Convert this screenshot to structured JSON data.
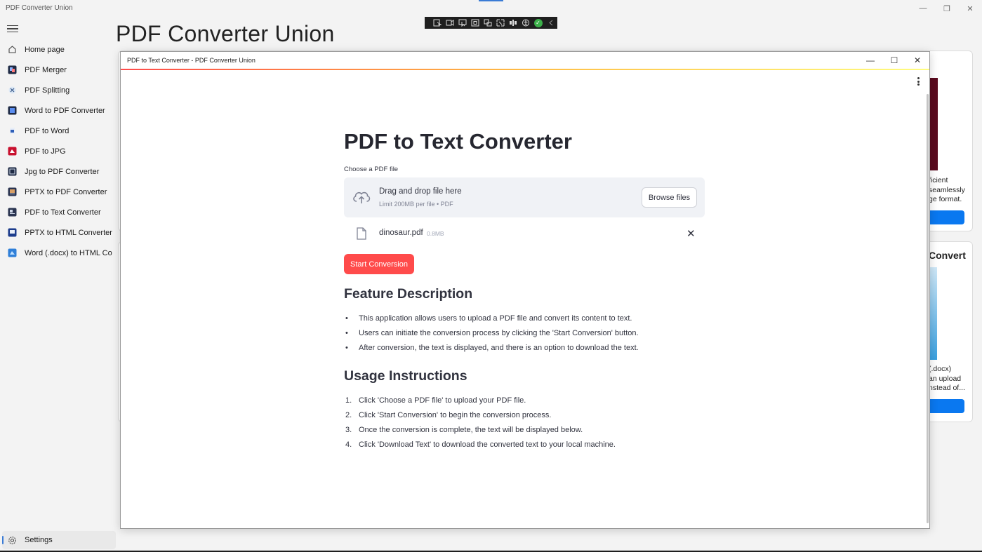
{
  "app": {
    "title": "PDF Converter Union",
    "main_title": "PDF Converter Union"
  },
  "window_controls": {
    "minimize": "—",
    "restore": "❐",
    "close": "✕"
  },
  "sidebar": {
    "items": [
      {
        "label": "Home page",
        "icon": "home-icon"
      },
      {
        "label": "PDF Merger",
        "icon": "pdf-merger-icon"
      },
      {
        "label": "PDF Splitting",
        "icon": "pdf-splitting-icon"
      },
      {
        "label": "Word to PDF Converter",
        "icon": "word-to-pdf-icon"
      },
      {
        "label": "PDF to Word",
        "icon": "pdf-to-word-icon"
      },
      {
        "label": "PDF to JPG",
        "icon": "pdf-to-jpg-icon"
      },
      {
        "label": "Jpg to PDF Converter",
        "icon": "jpg-to-pdf-icon"
      },
      {
        "label": "PPTX to PDF Converter",
        "icon": "pptx-to-pdf-icon"
      },
      {
        "label": "PDF to Text Converter",
        "icon": "pdf-to-text-icon"
      },
      {
        "label": "PPTX to HTML Converter",
        "icon": "pptx-to-html-icon"
      },
      {
        "label": "Word (.docx) to HTML Co",
        "icon": "word-to-html-icon"
      }
    ],
    "settings_label": "Settings"
  },
  "background_cards": {
    "card1_lines": [
      "ficient",
      "seamlessly",
      "ge format."
    ],
    "card2_title": "Convert",
    "card2_lines": [
      "(.docx)",
      "an upload",
      "nstead of..."
    ]
  },
  "dialog": {
    "title": "PDF to Text Converter - PDF Converter Union",
    "controls": {
      "minimize": "—",
      "maximize": "☐",
      "close": "✕"
    },
    "heading": "PDF to Text Converter",
    "upload": {
      "label": "Choose a PDF file",
      "drag_text": "Drag and drop file here",
      "limit_text": "Limit 200MB per file • PDF",
      "browse_label": "Browse files"
    },
    "file": {
      "name": "dinosaur.pdf",
      "size": "0.8MB",
      "remove": "✕"
    },
    "start_button": "Start Conversion",
    "feature_heading": "Feature Description",
    "features": [
      "This application allows users to upload a PDF file and convert its content to text.",
      "Users can initiate the conversion process by clicking the 'Start Conversion' button.",
      "After conversion, the text is displayed, and there is an option to download the text."
    ],
    "usage_heading": "Usage Instructions",
    "usage": [
      {
        "num": "1.",
        "text": "Click 'Choose a PDF file' to upload your PDF file."
      },
      {
        "num": "2.",
        "text": "Click 'Start Conversion' to begin the conversion process."
      },
      {
        "num": "3.",
        "text": "Once the conversion is complete, the text will be displayed below."
      },
      {
        "num": "4.",
        "text": "Click 'Download Text' to download the converted text to your local machine."
      }
    ]
  },
  "colors": {
    "accent_red": "#ff4b4b",
    "accent_blue": "#0a78f0",
    "success_green": "#3cb04a"
  }
}
